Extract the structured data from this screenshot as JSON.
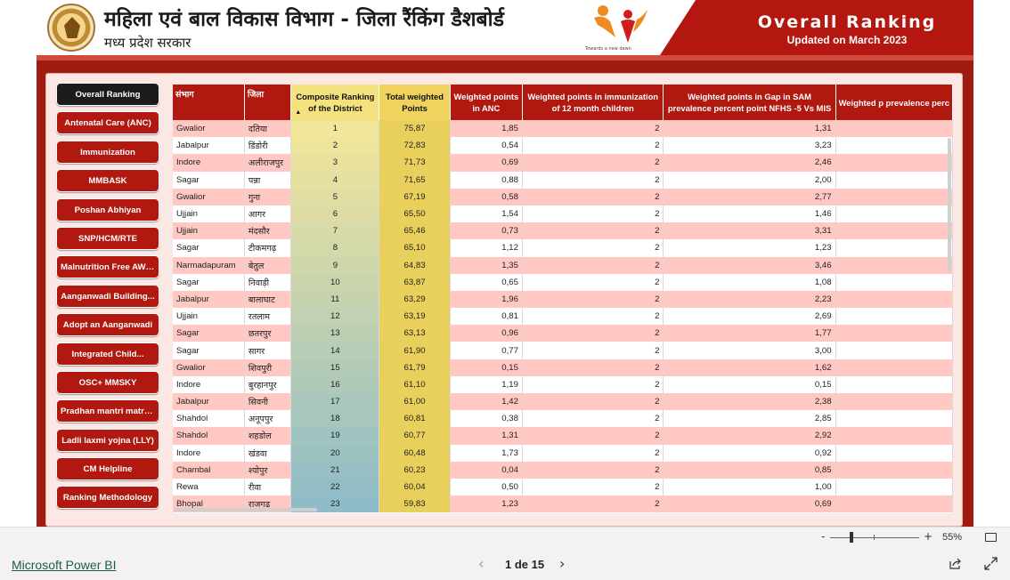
{
  "header": {
    "title_hi": "महिला एवं बाल विकास विभाग - जिला रैंकिंग डैशबोर्ड",
    "subtitle_hi": "मध्य प्रदेश सरकार",
    "logo_tagline": "Towards a new dawn",
    "right_title": "Overall Ranking",
    "right_subtitle": "Updated on March 2023"
  },
  "nav": {
    "items": [
      {
        "label": "Overall Ranking",
        "active": true
      },
      {
        "label": "Antenatal Care (ANC)"
      },
      {
        "label": "Immunization"
      },
      {
        "label": "MMBASK"
      },
      {
        "label": "Poshan Abhiyan"
      },
      {
        "label": "SNP/HCM/RTE"
      },
      {
        "label": "Malnutrition Free AWCs"
      },
      {
        "label": "Aanganwadi Building..."
      },
      {
        "label": "Adopt an Aanganwadi"
      },
      {
        "label": "Integrated Child..."
      },
      {
        "label": "OSC+ MMSKY"
      },
      {
        "label": "Pradhan mantri matru..."
      },
      {
        "label": "Ladli laxmi yojna (LLY)"
      },
      {
        "label": "CM Helpline"
      },
      {
        "label": "Ranking Methodology"
      }
    ]
  },
  "table": {
    "columns": [
      "संभाग",
      "जिला",
      "Composite Ranking of the District",
      "Total weighted Points",
      "Weighted points in ANC",
      "Weighted points in immunization of 12 month children",
      "Weighted points in Gap in SAM prevalence percent point NFHS -5 Vs MIS",
      "Weighted p prevalence perc"
    ],
    "rows": [
      [
        "Gwalior",
        "दतिया",
        "1",
        "75,87",
        "1,85",
        "2",
        "1,31",
        ""
      ],
      [
        "Jabalpur",
        "डिंडोरी",
        "2",
        "72,83",
        "0,54",
        "2",
        "3,23",
        ""
      ],
      [
        "Indore",
        "अलीराजपुर",
        "3",
        "71,73",
        "0,69",
        "2",
        "2,46",
        ""
      ],
      [
        "Sagar",
        "पन्ना",
        "4",
        "71,65",
        "0,88",
        "2",
        "2,00",
        ""
      ],
      [
        "Gwalior",
        "गुना",
        "5",
        "67,19",
        "0,58",
        "2",
        "2,77",
        ""
      ],
      [
        "Ujjain",
        "आगर",
        "6",
        "65,50",
        "1,54",
        "2",
        "1,46",
        ""
      ],
      [
        "Ujjain",
        "मंदसौर",
        "7",
        "65,46",
        "0,73",
        "2",
        "3,31",
        ""
      ],
      [
        "Sagar",
        "टीकमगढ़",
        "8",
        "65,10",
        "1,12",
        "2",
        "1,23",
        ""
      ],
      [
        "Narmadapuram",
        "बेतुल",
        "9",
        "64,83",
        "1,35",
        "2",
        "3,46",
        ""
      ],
      [
        "Sagar",
        "निवाड़ी",
        "10",
        "63,87",
        "0,65",
        "2",
        "1,08",
        ""
      ],
      [
        "Jabalpur",
        "बालाघाट",
        "11",
        "63,29",
        "1,96",
        "2",
        "2,23",
        ""
      ],
      [
        "Ujjain",
        "रतलाम",
        "12",
        "63,19",
        "0,81",
        "2",
        "2,69",
        ""
      ],
      [
        "Sagar",
        "छतरपुर",
        "13",
        "63,13",
        "0,96",
        "2",
        "1,77",
        ""
      ],
      [
        "Sagar",
        "सागर",
        "14",
        "61,90",
        "0,77",
        "2",
        "3,00",
        ""
      ],
      [
        "Gwalior",
        "शिवपुरी",
        "15",
        "61,79",
        "0,15",
        "2",
        "1,62",
        ""
      ],
      [
        "Indore",
        "बुरहानपुर",
        "16",
        "61,10",
        "1,19",
        "2",
        "0,15",
        ""
      ],
      [
        "Jabalpur",
        "सिवनी",
        "17",
        "61,00",
        "1,42",
        "2",
        "2,38",
        ""
      ],
      [
        "Shahdol",
        "अनूपपुर",
        "18",
        "60,81",
        "0,38",
        "2",
        "2,85",
        ""
      ],
      [
        "Shahdol",
        "शहडोल",
        "19",
        "60,77",
        "1,31",
        "2",
        "2,92",
        ""
      ],
      [
        "Indore",
        "खंडवा",
        "20",
        "60,48",
        "1,73",
        "2",
        "0,92",
        ""
      ],
      [
        "Chambal",
        "श्योपुर",
        "21",
        "60,23",
        "0,04",
        "2",
        "0,85",
        ""
      ],
      [
        "Rewa",
        "रीवा",
        "22",
        "60,04",
        "0,50",
        "2",
        "1,00",
        ""
      ],
      [
        "Bhopal",
        "राजगढ़",
        "23",
        "59,83",
        "1,23",
        "2",
        "0,69",
        ""
      ]
    ]
  },
  "zoom": {
    "minus": "-",
    "plus": "+",
    "value": "55%"
  },
  "footer": {
    "brand": "Microsoft Power BI",
    "page_label": "1 de 15",
    "prev": "‹",
    "next": "›"
  },
  "colors": {
    "accent": "#b01810",
    "row_alt": "#ffc8c2",
    "rank_gradient_start": "#f2e69a",
    "rank_gradient_end": "#8fbcc8",
    "points_col": "#e9cf5c"
  }
}
